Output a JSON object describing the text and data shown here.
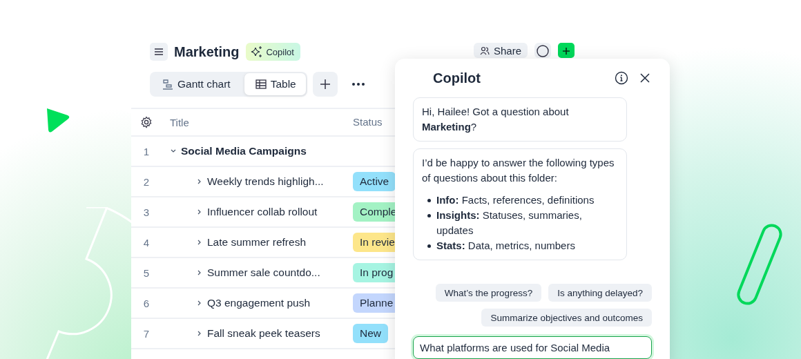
{
  "header": {
    "title": "Marketing",
    "copilot_badge": "Copilot",
    "share": "Share"
  },
  "views": [
    {
      "label": "Gantt chart",
      "kind": "gantt",
      "selected": false
    },
    {
      "label": "Table",
      "kind": "table",
      "selected": true
    }
  ],
  "table": {
    "columns": [
      "Title",
      "Status"
    ],
    "rows": [
      {
        "number": "1",
        "title": "Social Media Campaigns",
        "expanded": true,
        "children": [
          {
            "number": "2",
            "title": "Weekly trends highligh...",
            "expanded": false,
            "status": {
              "label": "Active",
              "color": "#93e0fb"
            }
          },
          {
            "number": "3",
            "title": "Influencer collab rollout",
            "expanded": false,
            "status": {
              "label": "Comple",
              "color": "#a3f2c4"
            }
          },
          {
            "number": "4",
            "title": "Late summer refresh",
            "expanded": false,
            "status": {
              "label": "In revie",
              "color": "#fde68a"
            }
          },
          {
            "number": "5",
            "title": "Summer sale countdo...",
            "expanded": false,
            "status": {
              "label": "In prog",
              "color": "#a6f4e2"
            }
          },
          {
            "number": "6",
            "title": "Q3 engagement push",
            "expanded": false,
            "status": {
              "label": "Planne",
              "color": "#c3d6fd"
            }
          },
          {
            "number": "7",
            "title": "Fall sneak peek teasers",
            "expanded": false,
            "status": {
              "label": "New",
              "color": "#93e0fb"
            }
          }
        ]
      }
    ]
  },
  "copilot": {
    "title": "Copilot",
    "messages": [
      {
        "text": "Hi, Hailee! Got a question about **Marketing**?"
      },
      {
        "text": "I’d be happy to answer the following types of questions about this folder:",
        "bullets": [
          "**Info:**  Facts, references, definitions",
          "**Insights:**  Statuses, summaries, updates",
          "**Stats:**  Data, metrics, numbers"
        ]
      }
    ],
    "suggestions": [
      "What’s the progress?",
      "Is anything delayed?",
      "Summarize objectives and outcomes"
    ],
    "input": {
      "value": "What platforms are used for Social Media"
    }
  }
}
